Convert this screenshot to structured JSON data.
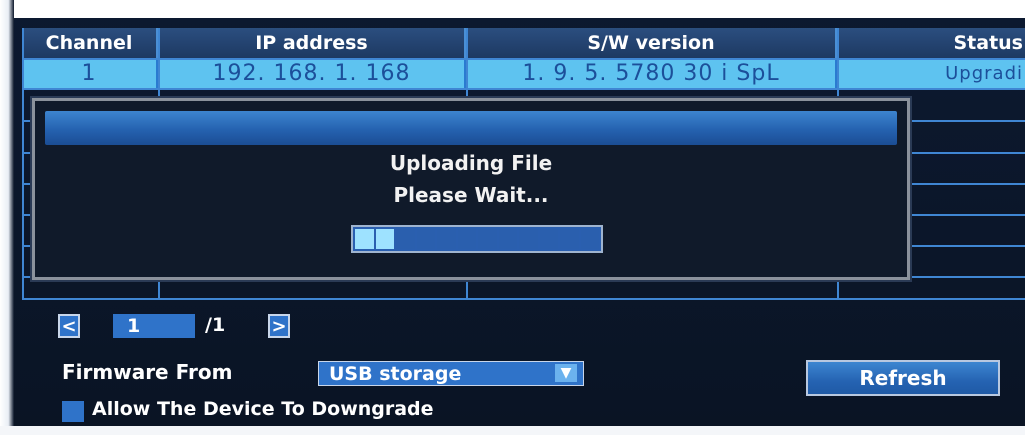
{
  "table": {
    "headers": [
      "Channel",
      "IP address",
      "S/W version",
      "Status"
    ],
    "row": {
      "channel": "1",
      "ip": "192. 168. 1. 168",
      "version": "1. 9. 5. 5780 30 i SpL",
      "status": "Upgradi"
    }
  },
  "dialog": {
    "line1": "Uploading File",
    "line2": "Please Wait...",
    "progress": 0.17
  },
  "pagination": {
    "prev_icon": "chevron-left-icon",
    "next_icon": "chevron-right-icon",
    "prev": "<",
    "next": ">",
    "current": "1",
    "total": "/1"
  },
  "firmware": {
    "label": "Firmware From",
    "source": "USB storage"
  },
  "refresh_label": "Refresh",
  "downgrade_label": "Allow The Device To Downgrade",
  "colors": {
    "header": "#1d3962",
    "selected_row": "#5ec3f0",
    "accent": "#2f73c9"
  }
}
